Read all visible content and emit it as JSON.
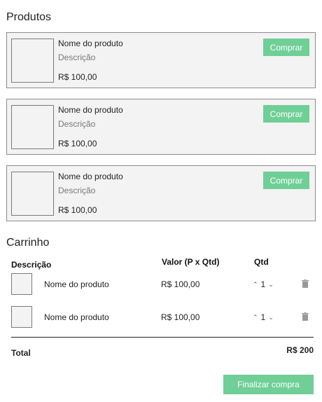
{
  "products_title": "Produtos",
  "products": [
    {
      "name": "Nome do produto",
      "description": "Descrição",
      "price": "R$ 100,00",
      "buy_label": "Comprar"
    },
    {
      "name": "Nome do produto",
      "description": "Descrição",
      "price": "R$ 100,00",
      "buy_label": "Comprar"
    },
    {
      "name": "Nome do produto",
      "description": "Descrição",
      "price": "R$ 100,00",
      "buy_label": "Comprar"
    }
  ],
  "cart_title": "Carrinho",
  "cart_headers": {
    "description": "Descrição",
    "value": "Valor (P x Qtd)",
    "qty": "Qtd"
  },
  "cart_items": [
    {
      "name": "Nome do produto",
      "price": "R$ 100,00",
      "qty": "1"
    },
    {
      "name": "Nome do produto",
      "price": "R$ 100,00",
      "qty": "1"
    }
  ],
  "total_label": "Total",
  "total_value": "R$ 200",
  "finish_label": "Finalizar compra",
  "colors": {
    "accent": "#6fcf97",
    "card_bg": "#f3f3f3",
    "border": "#8c8c8c"
  }
}
